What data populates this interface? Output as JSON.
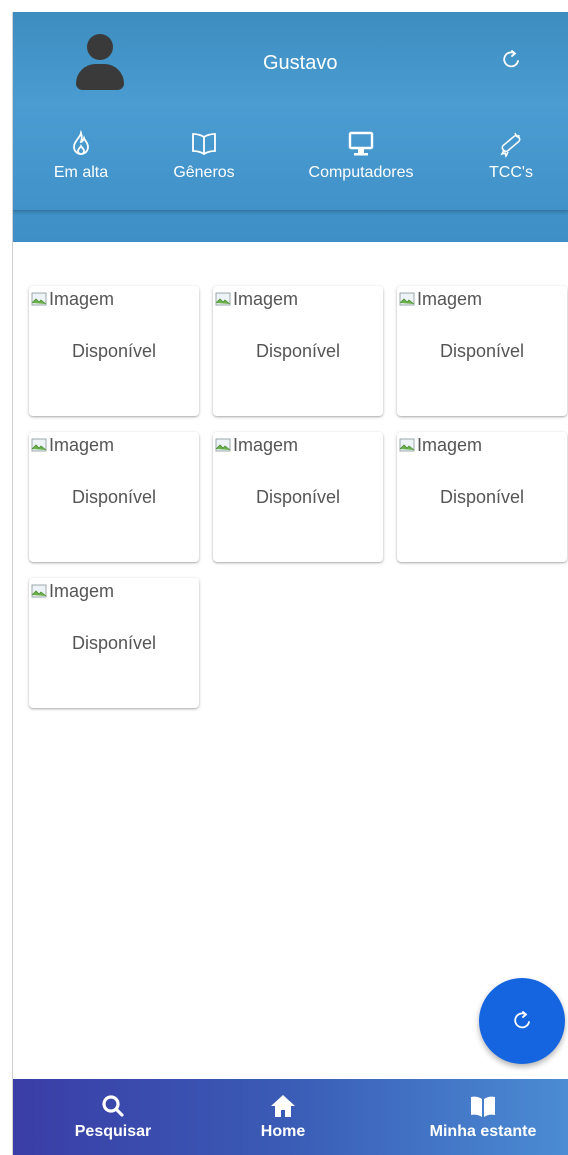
{
  "header": {
    "username": "Gustavo"
  },
  "categories": [
    {
      "label": "Em alta",
      "icon": "flame-icon"
    },
    {
      "label": "Gêneros",
      "icon": "open-book-icon"
    },
    {
      "label": "Computadores",
      "icon": "monitor-icon"
    },
    {
      "label": "TCC's",
      "icon": "diploma-icon"
    }
  ],
  "cards": [
    {
      "alt": "Imagem",
      "status": "Disponível"
    },
    {
      "alt": "Imagem",
      "status": "Disponível"
    },
    {
      "alt": "Imagem",
      "status": "Disponível"
    },
    {
      "alt": "Imagem",
      "status": "Disponível"
    },
    {
      "alt": "Imagem",
      "status": "Disponível"
    },
    {
      "alt": "Imagem",
      "status": "Disponível"
    },
    {
      "alt": "Imagem",
      "status": "Disponível"
    }
  ],
  "bottom_nav": {
    "search": "Pesquisar",
    "home": "Home",
    "shelf": "Minha estante"
  },
  "colors": {
    "header": "#4a9cd1",
    "fab": "#1565e0",
    "nav_start": "#3a3da6",
    "nav_end": "#4b8cd4"
  }
}
